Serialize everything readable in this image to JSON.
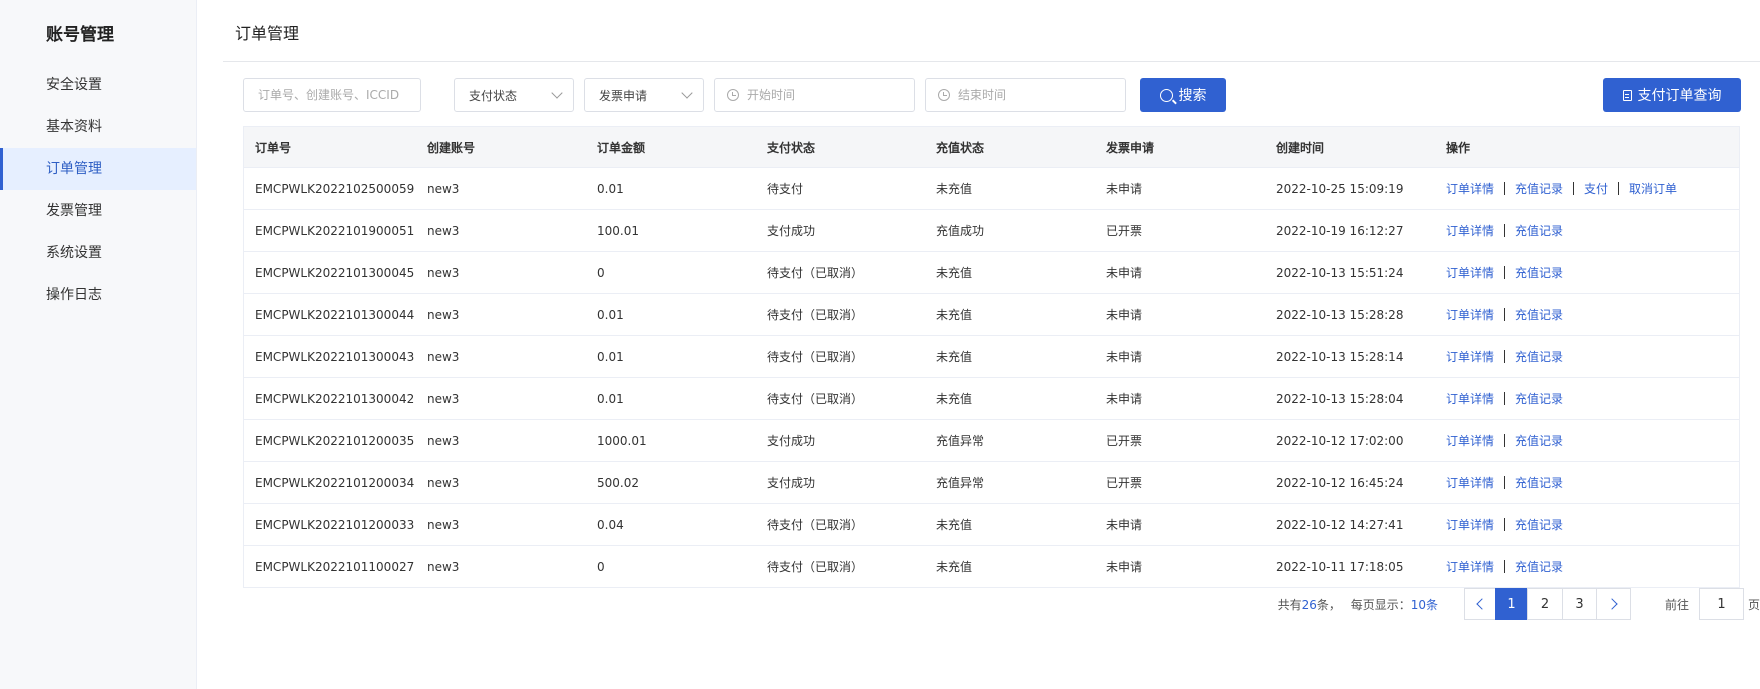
{
  "sidebar": {
    "title": "账号管理",
    "items": [
      {
        "label": "安全设置",
        "active": false
      },
      {
        "label": "基本资料",
        "active": false
      },
      {
        "label": "订单管理",
        "active": true
      },
      {
        "label": "发票管理",
        "active": false
      },
      {
        "label": "系统设置",
        "active": false
      },
      {
        "label": "操作日志",
        "active": false
      }
    ]
  },
  "header": {
    "title": "订单管理"
  },
  "filters": {
    "keyword_placeholder": "订单号、创建账号、ICCID",
    "keyword_value": "",
    "pay_status_label": "支付状态",
    "invoice_label": "发票申请",
    "start_placeholder": "开始时间",
    "end_placeholder": "结束时间",
    "search_label": "搜索",
    "query_label": "支付订单查询"
  },
  "table": {
    "columns": [
      "订单号",
      "创建账号",
      "订单金额",
      "支付状态",
      "充值状态",
      "发票申请",
      "创建时间",
      "操作"
    ],
    "rows": [
      {
        "order_no": "EMCPWLK2022102500059",
        "account": "new3",
        "amount": "0.01",
        "pay_status": "待支付",
        "recharge_status": "未充值",
        "invoice": "未申请",
        "created": "2022-10-25 15:09:19",
        "actions": [
          "订单详情",
          "充值记录",
          "支付",
          "取消订单"
        ]
      },
      {
        "order_no": "EMCPWLK2022101900051",
        "account": "new3",
        "amount": "100.01",
        "pay_status": "支付成功",
        "recharge_status": "充值成功",
        "invoice": "已开票",
        "created": "2022-10-19 16:12:27",
        "actions": [
          "订单详情",
          "充值记录"
        ]
      },
      {
        "order_no": "EMCPWLK2022101300045",
        "account": "new3",
        "amount": "0",
        "pay_status": "待支付（已取消）",
        "recharge_status": "未充值",
        "invoice": "未申请",
        "created": "2022-10-13 15:51:24",
        "actions": [
          "订单详情",
          "充值记录"
        ]
      },
      {
        "order_no": "EMCPWLK2022101300044",
        "account": "new3",
        "amount": "0.01",
        "pay_status": "待支付（已取消）",
        "recharge_status": "未充值",
        "invoice": "未申请",
        "created": "2022-10-13 15:28:28",
        "actions": [
          "订单详情",
          "充值记录"
        ]
      },
      {
        "order_no": "EMCPWLK2022101300043",
        "account": "new3",
        "amount": "0.01",
        "pay_status": "待支付（已取消）",
        "recharge_status": "未充值",
        "invoice": "未申请",
        "created": "2022-10-13 15:28:14",
        "actions": [
          "订单详情",
          "充值记录"
        ]
      },
      {
        "order_no": "EMCPWLK2022101300042",
        "account": "new3",
        "amount": "0.01",
        "pay_status": "待支付（已取消）",
        "recharge_status": "未充值",
        "invoice": "未申请",
        "created": "2022-10-13 15:28:04",
        "actions": [
          "订单详情",
          "充值记录"
        ]
      },
      {
        "order_no": "EMCPWLK2022101200035",
        "account": "new3",
        "amount": "1000.01",
        "pay_status": "支付成功",
        "recharge_status": "充值异常",
        "invoice": "已开票",
        "created": "2022-10-12 17:02:00",
        "actions": [
          "订单详情",
          "充值记录"
        ]
      },
      {
        "order_no": "EMCPWLK2022101200034",
        "account": "new3",
        "amount": "500.02",
        "pay_status": "支付成功",
        "recharge_status": "充值异常",
        "invoice": "已开票",
        "created": "2022-10-12 16:45:24",
        "actions": [
          "订单详情",
          "充值记录"
        ]
      },
      {
        "order_no": "EMCPWLK2022101200033",
        "account": "new3",
        "amount": "0.04",
        "pay_status": "待支付（已取消）",
        "recharge_status": "未充值",
        "invoice": "未申请",
        "created": "2022-10-12 14:27:41",
        "actions": [
          "订单详情",
          "充值记录"
        ]
      },
      {
        "order_no": "EMCPWLK2022101100027",
        "account": "new3",
        "amount": "0",
        "pay_status": "待支付（已取消）",
        "recharge_status": "未充值",
        "invoice": "未申请",
        "created": "2022-10-11 17:18:05",
        "actions": [
          "订单详情",
          "充值记录"
        ]
      }
    ]
  },
  "pagination": {
    "total_prefix": "共有",
    "total_count": "26",
    "total_suffix": "条，",
    "per_page_prefix": "每页显示：",
    "per_page": "10条",
    "pages": [
      "1",
      "2",
      "3"
    ],
    "current_page": "1",
    "goto_prefix": "前往",
    "goto_value": "1",
    "goto_suffix": "页"
  },
  "colors": {
    "accent": "#3061d1",
    "sidebar_bg": "#f7f8fa",
    "active_bg": "#e6efff"
  },
  "icons": {
    "search": "search-icon",
    "query": "document-icon",
    "clock": "clock-icon",
    "chevron_down": "chevron-down-icon",
    "prev": "chevron-left-icon",
    "next": "chevron-right-icon"
  }
}
